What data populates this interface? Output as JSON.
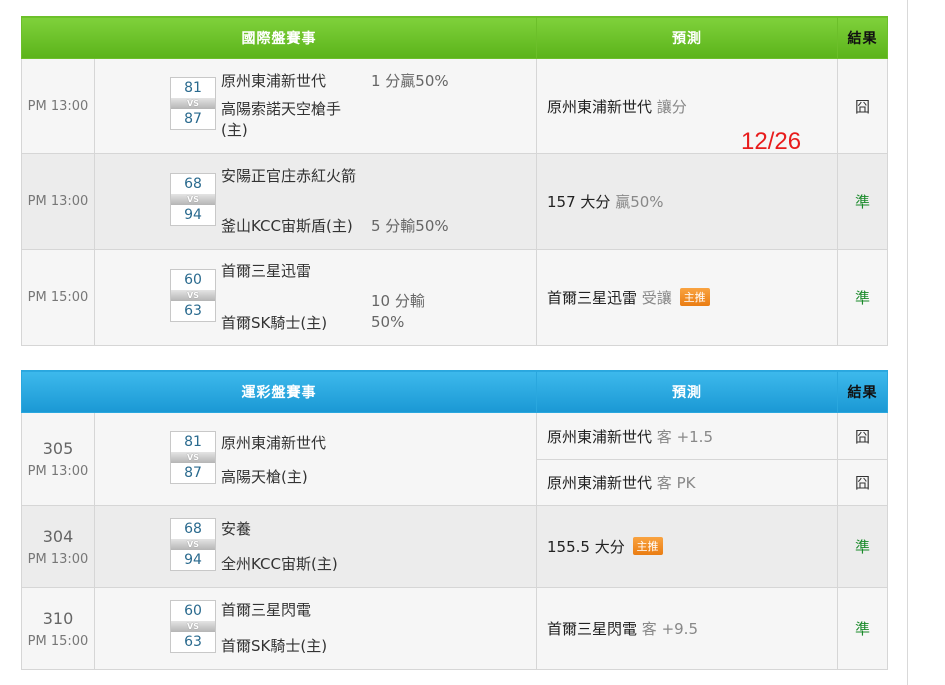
{
  "international": {
    "header": "國際盤賽事",
    "pred_header": "預測",
    "result_header": "結果",
    "rows": [
      {
        "time": "PM 13:00",
        "score_a": "81",
        "score_b": "87",
        "vs": "VS",
        "team_a": "原州東浦新世代",
        "team_b": "高陽索諾天空槍手(主)",
        "odds": "1 分贏50%",
        "pred": "原州東浦新世代",
        "pred_note": "讓分",
        "tag": "",
        "result": "囧"
      },
      {
        "time": "PM 13:00",
        "score_a": "68",
        "score_b": "94",
        "vs": "VS",
        "team_a": "安陽正官庄赤紅火箭",
        "team_b": "釜山KCC宙斯盾(主)",
        "odds": "5 分輸50%",
        "pred": "157 大分",
        "pred_note": "贏50%",
        "tag": "",
        "result": "準"
      },
      {
        "time": "PM 15:00",
        "score_a": "60",
        "score_b": "63",
        "vs": "VS",
        "team_a": "首爾三星迅雷",
        "team_b": "首爾SK騎士(主)",
        "odds": "10 分輸50%",
        "pred": "首爾三星迅雷",
        "pred_note": "受讓",
        "tag": "主推",
        "result": "準"
      }
    ]
  },
  "annotation": {
    "date": "12/26"
  },
  "lottery": {
    "header": "運彩盤賽事",
    "pred_header": "預測",
    "result_header": "結果",
    "rows": [
      {
        "num": "305",
        "time": "PM 13:00",
        "score_a": "81",
        "score_b": "87",
        "vs": "VS",
        "team_a": "原州東浦新世代",
        "team_b": "高陽天槍(主)",
        "preds": [
          {
            "pred": "原州東浦新世代",
            "pred_note": "客 +1.5",
            "tag": "",
            "result": "囧"
          },
          {
            "pred": "原州東浦新世代",
            "pred_note": "客 PK",
            "tag": "",
            "result": "囧"
          }
        ]
      },
      {
        "num": "304",
        "time": "PM 13:00",
        "score_a": "68",
        "score_b": "94",
        "vs": "VS",
        "team_a": "安養",
        "team_b": "全州KCC宙斯(主)",
        "preds": [
          {
            "pred": "155.5 大分",
            "pred_note": "",
            "tag": "主推",
            "result": "準"
          }
        ]
      },
      {
        "num": "310",
        "time": "PM 15:00",
        "score_a": "60",
        "score_b": "63",
        "vs": "VS",
        "team_a": "首爾三星閃電",
        "team_b": "首爾SK騎士(主)",
        "preds": [
          {
            "pred": "首爾三星閃電",
            "pred_note": "客 +9.5",
            "tag": "",
            "result": "準"
          }
        ]
      }
    ]
  },
  "colors": {
    "good": "#1a8a2a",
    "bad": "#333333",
    "green_header": "#66bb22",
    "blue_header": "#22a0da",
    "annotation": "#e81c1c"
  }
}
